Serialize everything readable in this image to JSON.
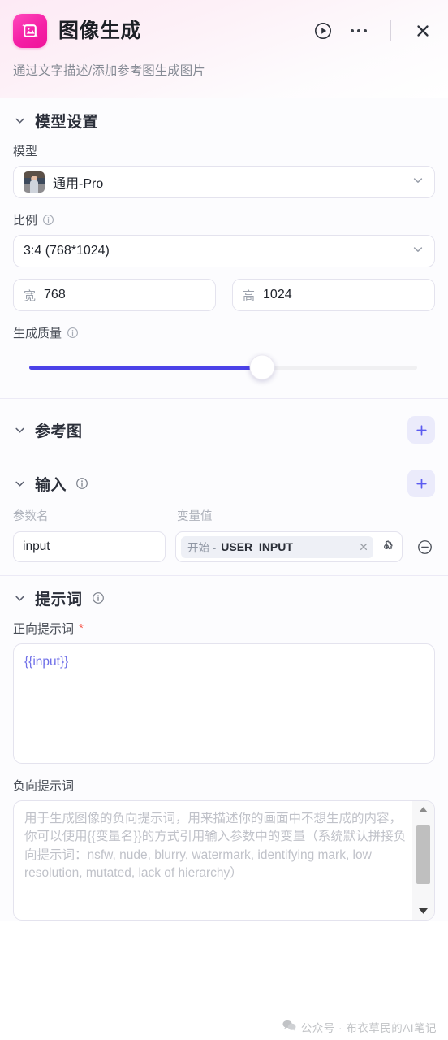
{
  "header": {
    "logo_icon": "image-sparkle-icon",
    "title": "图像生成",
    "subtitle": "通过文字描述/添加参考图生成图片",
    "run_icon": "play-circle-icon",
    "more_icon": "more-horizontal-icon",
    "close_icon": "close-icon"
  },
  "model_settings": {
    "section_title": "模型设置",
    "chevron_icon": "chevron-down-icon",
    "model": {
      "label": "模型",
      "value": "通用-Pro",
      "dropdown_icon": "chevron-down-icon",
      "thumbnail": "model-avatar"
    },
    "ratio": {
      "label": "比例",
      "info_icon": "info-circle-icon",
      "value": "3:4 (768*1024)",
      "dropdown_icon": "chevron-down-icon"
    },
    "width": {
      "label": "宽",
      "value": "768"
    },
    "height": {
      "label": "高",
      "value": "1024"
    },
    "quality": {
      "label": "生成质量",
      "info_icon": "info-circle-icon",
      "percent": 60
    }
  },
  "reference": {
    "section_title": "参考图",
    "chevron_icon": "chevron-down-icon",
    "add_icon": "plus-icon"
  },
  "input": {
    "section_title": "输入",
    "info_icon": "info-circle-icon",
    "chevron_icon": "chevron-down-icon",
    "add_icon": "plus-icon",
    "col_param_name": "参数名",
    "col_var_value": "变量值",
    "rows": [
      {
        "param_name": "input",
        "chip_prefix": "开始 -",
        "chip_value": "USER_INPUT",
        "clear_icon": "close-small-icon",
        "settings_icon": "gear-icon",
        "remove_icon": "minus-circle-icon"
      }
    ]
  },
  "prompt": {
    "section_title": "提示词",
    "info_icon": "info-circle-icon",
    "chevron_icon": "chevron-down-icon",
    "positive": {
      "label": "正向提示词",
      "required_mark": "*",
      "value": "{{input}}"
    },
    "negative": {
      "label": "负向提示词",
      "placeholder": "用于生成图像的负向提示词，用来描述你的画面中不想生成的内容，你可以使用{{变量名}}的方式引用输入参数中的变量（系统默认拼接负向提示词：nsfw, nude, blurry, watermark, identifying mark, low resolution, mutated, lack of hierarchy）",
      "scroll_up_icon": "triangle-up-icon",
      "scroll_down_icon": "triangle-down-icon"
    }
  },
  "watermark": {
    "icon": "wechat-icon",
    "text": "公众号 · 布衣草民的AI笔记"
  },
  "colors": {
    "brand_pink": "#f51fa6",
    "accent_indigo": "#4b41e8",
    "chip_bg": "#eef0f6",
    "required_red": "#f5483b"
  }
}
